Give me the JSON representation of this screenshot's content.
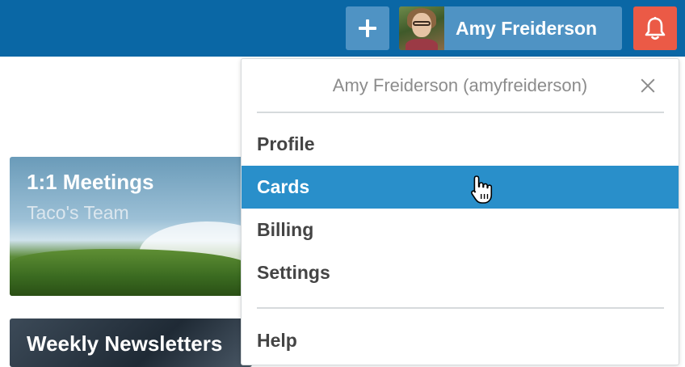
{
  "header": {
    "member_name": "Amy Freiderson",
    "icons": {
      "add": "plus-icon",
      "notifications": "bell-icon"
    },
    "colors": {
      "header_bg": "#0a67a5",
      "button_bg": "#4f93c4",
      "notification_bg": "#eb5a46"
    }
  },
  "boards": [
    {
      "title": "1:1 Meetings",
      "team": "Taco's Team"
    },
    {
      "title": "Weekly Newsletters"
    }
  ],
  "member_menu": {
    "title": "Amy Freiderson (amyfreiderson)",
    "items": [
      {
        "label": "Profile"
      },
      {
        "label": "Cards"
      },
      {
        "label": "Billing"
      },
      {
        "label": "Settings"
      },
      {
        "label": "Help"
      }
    ],
    "highlighted": "Cards",
    "highlight_color": "#298fca"
  }
}
